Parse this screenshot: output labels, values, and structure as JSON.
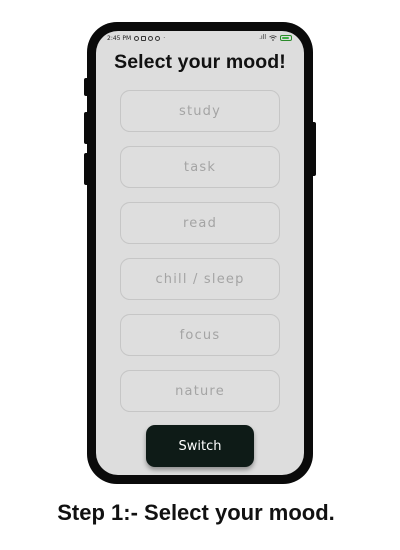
{
  "status_bar": {
    "time": "2:45 PM",
    "notification_icons": [
      "settings-icon",
      "mail-icon",
      "at-icon",
      "at-icon"
    ],
    "dot": "·",
    "signal": ".ıll",
    "wifi": "wifi-icon",
    "battery": "battery-icon"
  },
  "screen": {
    "title": "Select your mood!",
    "moods": [
      {
        "label": "study"
      },
      {
        "label": "task"
      },
      {
        "label": "read"
      },
      {
        "label": "chill / sleep"
      },
      {
        "label": "focus"
      },
      {
        "label": "nature"
      }
    ],
    "switch_label": "Switch"
  },
  "caption": "Step 1:- Select your mood.",
  "colors": {
    "screen_bg": "#dddddd",
    "switch_bg": "#0e1b17",
    "mood_text": "#a4a4a4",
    "mood_border": "#c6c6c6"
  }
}
